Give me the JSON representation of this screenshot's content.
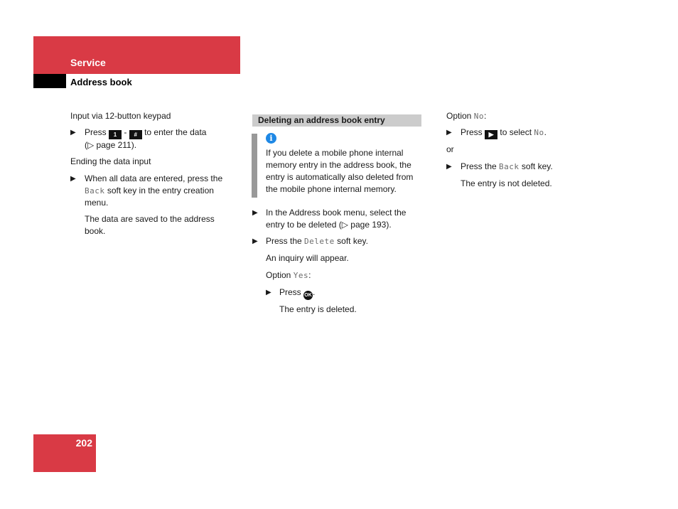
{
  "header": {
    "section": "Service",
    "subsection": "Address book"
  },
  "page_number": "202",
  "colors": {
    "brand_red": "#d93a45",
    "section_bar": "#cccccc",
    "note_bar": "#999999",
    "info_blue": "#1e88e5"
  },
  "col1": {
    "p1": "Input via 12-button keypad",
    "b1": {
      "pre": "Press",
      "key1": "1",
      "dash": "-",
      "key2": "#",
      "post": "to enter the data",
      "line2": "(▷ page 211)."
    },
    "p2": "Ending the data input",
    "b2": {
      "line1": "When all data are entered, press the",
      "mono": "Back",
      "line2rest": "soft key in the entry creation",
      "line3": "menu."
    },
    "p3": {
      "line1": "The data are saved to the address",
      "line2": "book."
    }
  },
  "col2": {
    "section_title": "Deleting an address book entry",
    "note": {
      "icon": "info-icon",
      "lines": [
        "If you delete a mobile phone internal",
        "memory entry in the address book, the",
        "entry is automatically also deleted from",
        "the mobile phone internal memory."
      ]
    },
    "b1": {
      "line1": "In the Address book menu, select the",
      "line2": "entry to be deleted (▷ page 193)."
    },
    "b2": {
      "pre": "Press the",
      "mono": "Delete",
      "post": "soft key."
    },
    "p1": "An inquiry will appear.",
    "option_yes": {
      "pre": "Option",
      "mono": "Yes",
      "post": ":"
    },
    "b3": {
      "pre": "Press",
      "key": "OK",
      "post": "."
    },
    "p2": "The entry is deleted."
  },
  "col3": {
    "option_no": {
      "pre": "Option",
      "mono": "No",
      "post": ":"
    },
    "b1": {
      "pre": "Press",
      "key": "▶",
      "mid": "to select",
      "mono": "No",
      "post": "."
    },
    "or": "or",
    "b2": {
      "pre": "Press the",
      "mono": "Back",
      "post": "soft key."
    },
    "p1": "The entry is not deleted."
  },
  "bullet_glyph": "▶"
}
